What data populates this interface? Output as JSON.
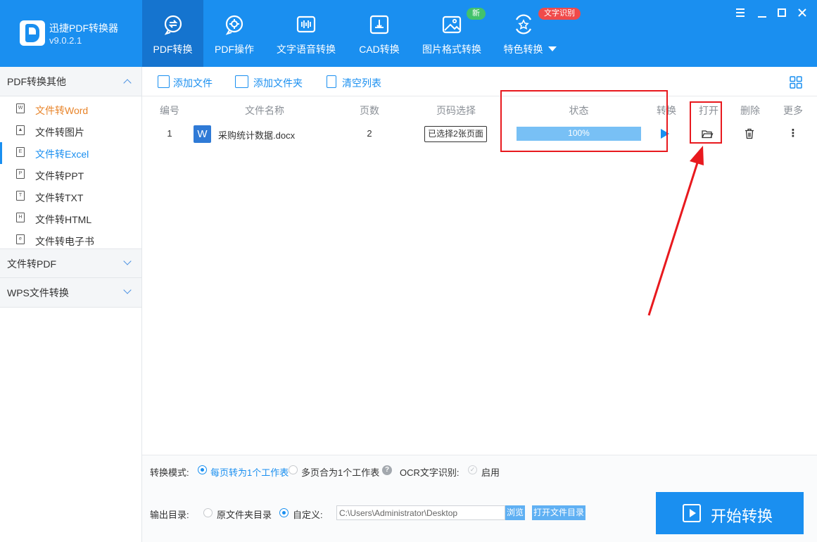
{
  "app": {
    "name": "迅捷PDF转换器",
    "version": "v9.0.2.1"
  },
  "nav": {
    "tabs": [
      {
        "label": "PDF转换",
        "icon": "pdf-convert-icon"
      },
      {
        "label": "PDF操作",
        "icon": "pdf-gear-icon"
      },
      {
        "label": "文字语音转换",
        "icon": "waveform-icon"
      },
      {
        "label": "CAD转换",
        "icon": "cad-icon"
      },
      {
        "label": "图片格式转换",
        "icon": "image-icon"
      },
      {
        "label": "特色转换",
        "icon": "star-icon"
      }
    ],
    "badge_new": "新",
    "badge_ocr": "文字识别"
  },
  "sidebar": {
    "sections": [
      {
        "title": "PDF转换其他"
      },
      {
        "title": "文件转PDF"
      },
      {
        "title": "WPS文件转换"
      }
    ],
    "items": [
      {
        "label": "文件转Word",
        "icon_char": "W"
      },
      {
        "label": "文件转图片",
        "icon_char": "▲"
      },
      {
        "label": "文件转Excel",
        "icon_char": "E"
      },
      {
        "label": "文件转PPT",
        "icon_char": "P"
      },
      {
        "label": "文件转TXT",
        "icon_char": "T"
      },
      {
        "label": "文件转HTML",
        "icon_char": "H"
      },
      {
        "label": "文件转电子书",
        "icon_char": "e"
      }
    ]
  },
  "toolbar": {
    "add_file": "添加文件",
    "add_folder": "添加文件夹",
    "clear_list": "清空列表"
  },
  "table": {
    "headers": {
      "index": "编号",
      "filename": "文件名称",
      "pages": "页数",
      "page_select": "页码选择",
      "status": "状态",
      "convert": "转换",
      "open": "打开",
      "delete": "删除",
      "more": "更多"
    },
    "rows": [
      {
        "index": "1",
        "file_icon": "W",
        "filename": "采购统计数据.docx",
        "pages": "2",
        "page_select": "已选择2张页面",
        "progress": "100%",
        "more": "⋮"
      }
    ]
  },
  "options": {
    "mode_label": "转换模式:",
    "mode_option1": "每页转为1个工作表",
    "mode_option2": "多页合为1个工作表",
    "help": "?",
    "ocr_label": "OCR文字识别:",
    "ocr_enable": "启用",
    "output_label": "输出目录:",
    "output_option1": "原文件夹目录",
    "output_option2": "自定义:",
    "output_path": "C:\\Users\\Administrator\\Desktop",
    "browse": "浏览",
    "open_folder": "打开文件目录"
  },
  "start_button": "开始转换",
  "colors": {
    "primary": "#1a8ff0",
    "active_tab": "#1574cf",
    "highlight": "#e8191e",
    "progress_fill": "#78c0f5",
    "sidebar_selected_orange": "#e8842a"
  }
}
